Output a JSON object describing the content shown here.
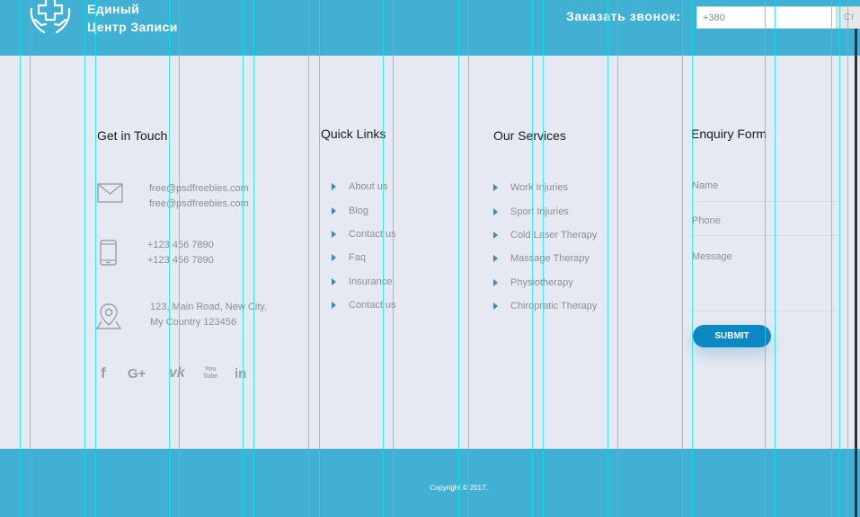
{
  "header": {
    "brand_line1": "Единый",
    "brand_line2": "Центр Записи",
    "callback_label": "Заказать звонок:",
    "phone_placeholder": "+380",
    "order_button": "Ст"
  },
  "columns": {
    "touch": {
      "title": "Get in Touch",
      "email1": "free@psdfreebies.com",
      "email2": "free@psdfreebies.com",
      "phone1": "+123 456 7890",
      "phone2": "+123 456 7890",
      "address1": "123, Main Road, New City,",
      "address2": "My Country 123456"
    },
    "quick_links": {
      "title": "Quick Links",
      "items": [
        "About us",
        "Blog",
        "Contact us",
        "Faq",
        "Insurance",
        "Contact us"
      ]
    },
    "services": {
      "title": "Our Services",
      "items": [
        "Work Injuries",
        "Sport Injuries",
        "Cold Laser Therapy",
        "Massage Therapy",
        "Physiotherapy",
        "Chiropratic Therapy"
      ]
    },
    "enquiry": {
      "title": "Enquiry Form",
      "name_placeholder": "Name",
      "phone_placeholder": "Phone",
      "message_placeholder": "Message",
      "submit_label": "SUBMIT"
    }
  },
  "social": {
    "facebook": "f",
    "google": "G+",
    "vk": "vk",
    "youtube": "You Tube",
    "linkedin": "in"
  },
  "footer": {
    "copyright": "Copyright © 2017."
  },
  "colors": {
    "accent": "#42b0d3",
    "button": "#0d88c4",
    "bullet": "#2d8fc7",
    "background": "#e6e9f1"
  }
}
